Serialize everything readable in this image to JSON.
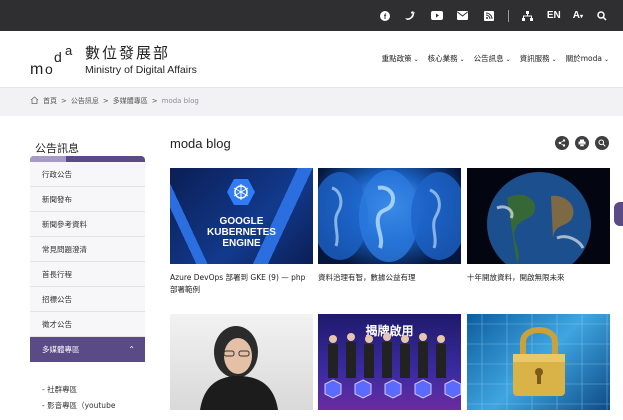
{
  "topbar": {
    "icons": [
      "facebook-icon",
      "twitter-icon",
      "youtube-icon",
      "mail-icon",
      "rss-icon",
      "sitemap-icon"
    ],
    "lang": "EN",
    "font_size": "A",
    "search": "search-icon"
  },
  "header": {
    "logo_mark": "moda",
    "name_zh": "數位發展部",
    "name_en": "Ministry of Digital Affairs",
    "nav": [
      "重點政策",
      "核心業務",
      "公告訊息",
      "資訊服務",
      "關於moda"
    ]
  },
  "breadcrumb": {
    "items": [
      "首頁",
      "公告訊息",
      "多媒體專區"
    ],
    "current": "moda blog"
  },
  "sidebar": {
    "title": "公告訊息",
    "items": [
      "行政公告",
      "新聞發布",
      "新聞參考資料",
      "常見問題澄清",
      "首長行程",
      "招標公告",
      "徵才公告"
    ],
    "active": "多媒體專區",
    "sub": [
      "- 社群專區",
      "- 影音專區（youtube"
    ]
  },
  "main": {
    "title": "moda blog",
    "cards": [
      {
        "caption": "Azure DevOps 部署到 GKE (9) — php 部署範例",
        "thumb_text": [
          "GOOGLE",
          "KUBERNETES",
          "ENGINE"
        ]
      },
      {
        "caption": "資料治理有智，數據公益有理",
        "thumb_text": []
      },
      {
        "caption": "十年開放資料，開啟無限未來",
        "thumb_text": []
      },
      {
        "caption": "",
        "thumb_text": []
      },
      {
        "caption": "",
        "thumb_text": [
          "揭牌啟用"
        ]
      },
      {
        "caption": "",
        "thumb_text": []
      }
    ]
  },
  "colors": {
    "brand": "#5a4a86",
    "topbar": "#2f2f31"
  }
}
